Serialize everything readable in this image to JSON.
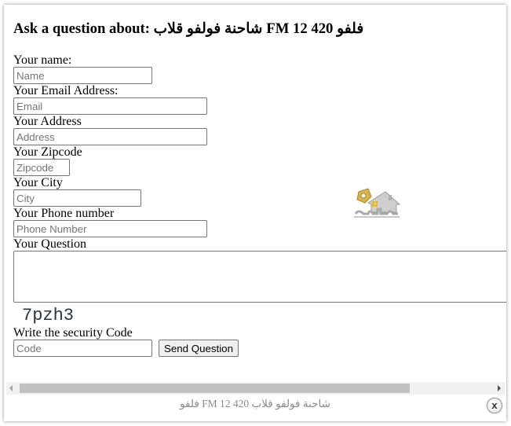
{
  "modal": {
    "title": "Ask a question about: شاحنة فولفو قلاب FM 12 420 فلفو",
    "caption": "شاحنة فولفو قلاب FM 12 420 فلفو",
    "close_label": "x"
  },
  "form": {
    "name": {
      "label": "Your name:",
      "placeholder": "Name",
      "value": ""
    },
    "email": {
      "label": "Your Email Address:",
      "placeholder": "Email",
      "value": ""
    },
    "address": {
      "label": "Your Address",
      "placeholder": "Address",
      "value": ""
    },
    "zipcode": {
      "label": "Your Zipcode",
      "placeholder": "Zipcode",
      "value": ""
    },
    "city": {
      "label": "Your City",
      "placeholder": "City",
      "value": ""
    },
    "phone": {
      "label": "Your Phone number",
      "placeholder": "Phone Number",
      "value": ""
    },
    "question": {
      "label": "Your Question",
      "value": ""
    },
    "captcha": {
      "text": "7pzh3"
    },
    "code": {
      "label": "Write the security Code",
      "placeholder": "Code",
      "value": ""
    },
    "submit_label": "Send Question"
  },
  "icons": {
    "logo": "house-key-logo-icon",
    "scroll_left": "arrow-left-icon",
    "scroll_right": "arrow-right-icon",
    "close": "close-icon"
  },
  "colors": {
    "logo_gold": "#d9b24a",
    "logo_gray": "#a9a9a9",
    "caption_text": "#8a8a8a",
    "scroll_thumb": "#c1c1c1"
  }
}
